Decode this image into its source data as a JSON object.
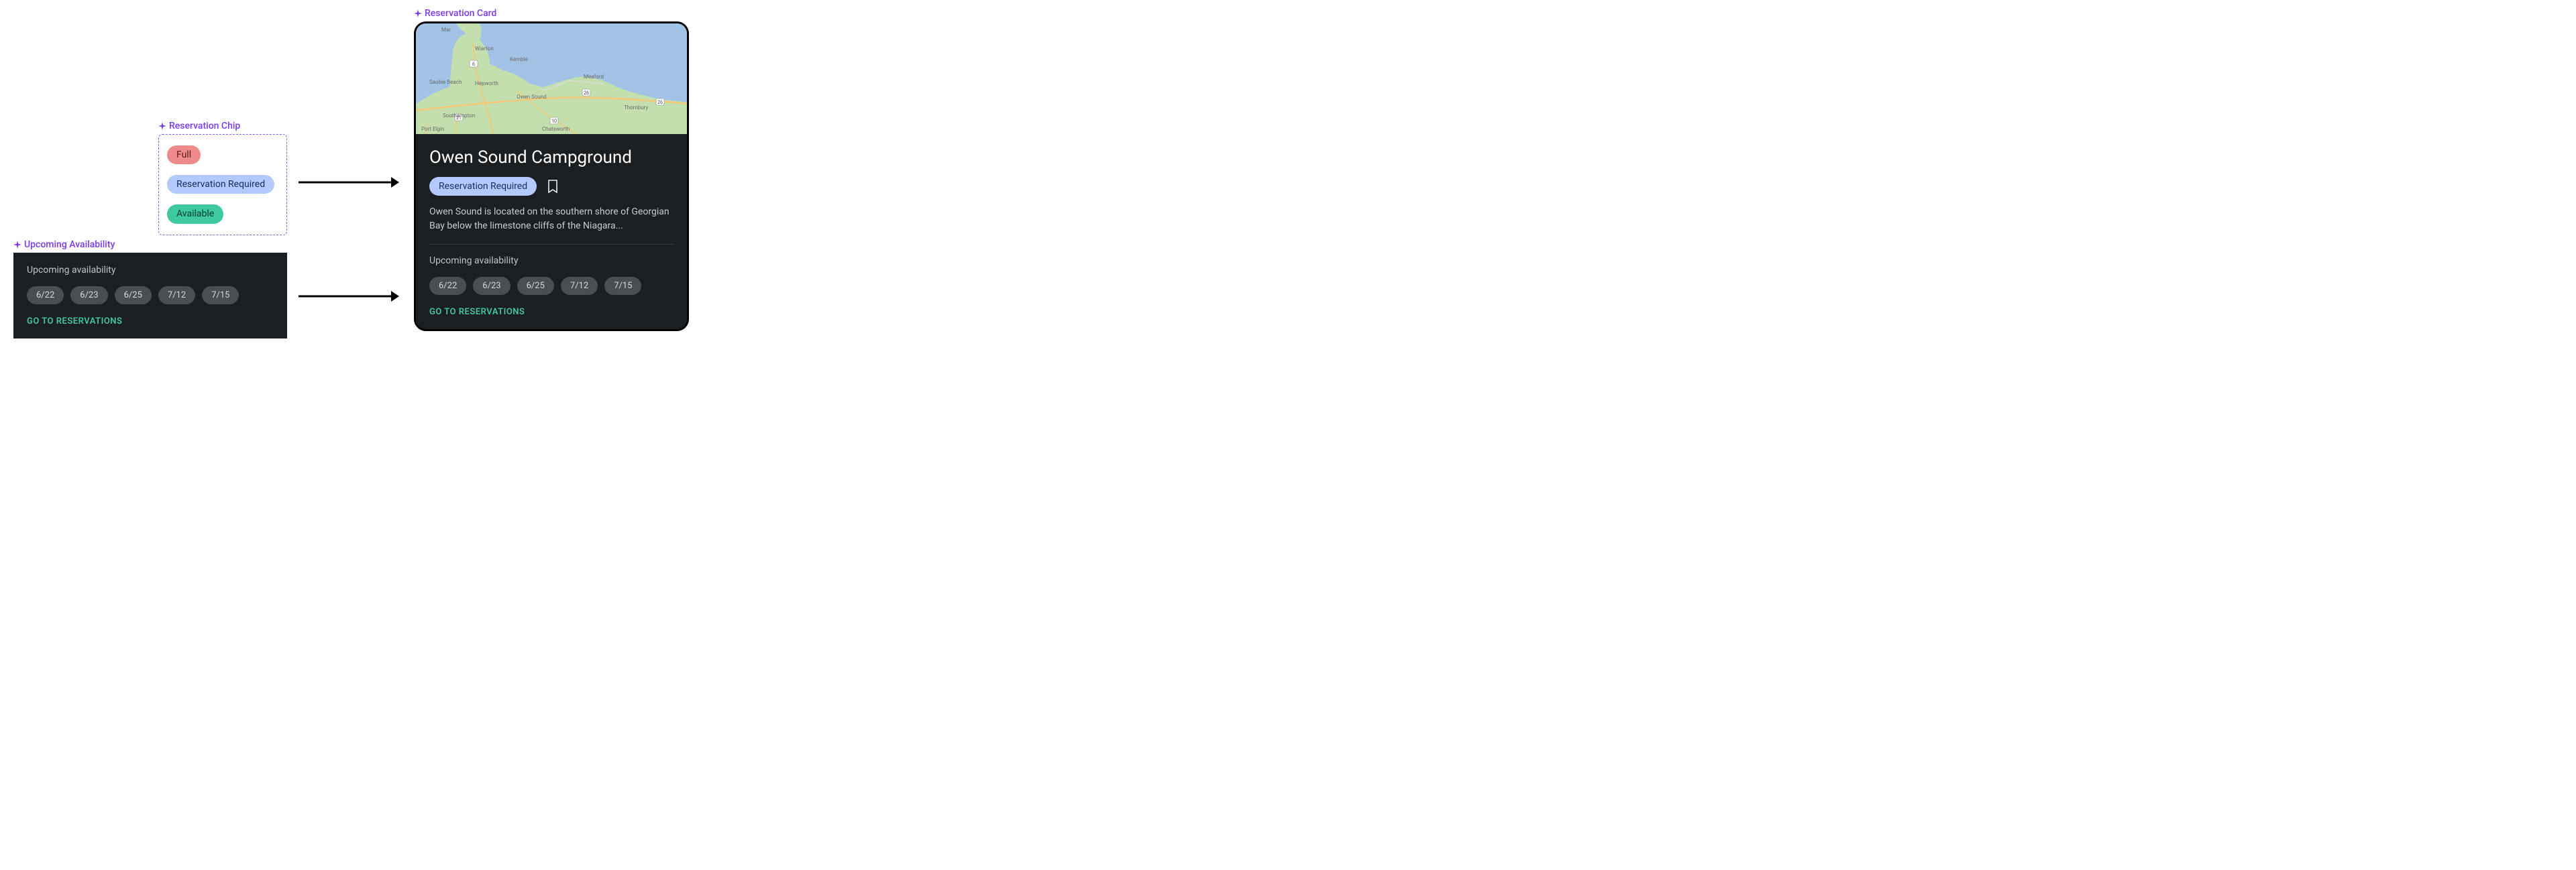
{
  "labels": {
    "reservation_chip": "Reservation Chip",
    "upcoming_availability": "Upcoming Availability",
    "reservation_card": "Reservation Card"
  },
  "chips": {
    "full": "Full",
    "reservation_required": "Reservation Required",
    "available": "Available"
  },
  "upcoming": {
    "title": "Upcoming availability",
    "dates": [
      "6/22",
      "6/23",
      "6/25",
      "7/12",
      "7/15"
    ],
    "link": "GO TO RESERVATIONS"
  },
  "card": {
    "title": "Owen Sound Campground",
    "status": "Reservation Required",
    "description": "Owen Sound is located on the southern shore of Georgian Bay below the limestone cliffs of the Niagara...",
    "upcoming_title": "Upcoming availability",
    "dates": [
      "6/22",
      "6/23",
      "6/25",
      "7/12",
      "7/15"
    ],
    "link": "GO TO RESERVATIONS",
    "map_places": {
      "wiarton": "Wiarton",
      "kemble": "Kemble",
      "sauble_beach": "Sauble Beach",
      "hepworth": "Hepworth",
      "meaford": "Meaford",
      "owen_sound": "Owen Sound",
      "thornbury": "Thornbury",
      "southampton": "Southampton",
      "port_elgin": "Port Elgin",
      "chatsworth": "Chatsworth",
      "mar": "Mar",
      "route_6": "6",
      "route_21": "21",
      "route_10": "10",
      "route_26a": "26",
      "route_26b": "26"
    }
  }
}
